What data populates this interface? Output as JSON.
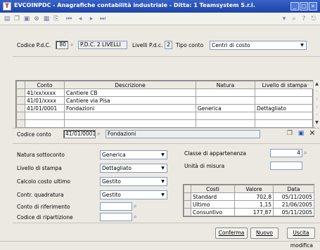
{
  "window": {
    "title": "EVCOINPDC - Anagrafiche contabilità industriale - Ditta: 1 Teamsystem S.r.l.",
    "app_icon": "T"
  },
  "header": {
    "codice_pdc_label": "Codice P.d.C.",
    "codice_pdc_value": "80",
    "pdc_desc": "P.D.C. 2 LIVELLI",
    "livelli_label": "Livelli P.d.c.",
    "livelli_value": "2",
    "tipo_conto_label": "Tipo conto",
    "tipo_conto_value": "Centri di costo"
  },
  "grid": {
    "columns": [
      "Conto",
      "Descrizione",
      "Natura",
      "Livello di stampa"
    ],
    "rows": [
      {
        "conto": "41/xx/xxxx",
        "descrizione": "Cantiere CB",
        "natura": "",
        "livello": ""
      },
      {
        "conto": "41/01/xxxx",
        "descrizione": "Cantiere via Pisa",
        "natura": "",
        "livello": ""
      },
      {
        "conto": "41/01/0001",
        "descrizione": "Fondazioni",
        "natura": "Generica",
        "livello": "Dettagliato"
      },
      {
        "conto": "",
        "descrizione": "",
        "natura": "",
        "livello": ""
      },
      {
        "conto": "",
        "descrizione": "",
        "natura": "",
        "livello": ""
      }
    ]
  },
  "detail": {
    "codice_conto_label": "Codice conto",
    "codice_conto_value": "41/01/0001",
    "codice_conto_desc": "Fondazioni",
    "natura_label": "Natura sottoconto",
    "natura_value": "Generica",
    "livello_label": "Livello di stampa",
    "livello_value": "Dettagliato",
    "calcolo_label": "Calcolo costo ultimo",
    "calcolo_value": "Gestito",
    "quadratura_label": "Contr. quadratura",
    "quadratura_value": "Gestito",
    "riferimento_label": "Conto di riferimento",
    "ripartizione_label": "Codice di ripartizione",
    "classe_label": "Classe di appartenenza",
    "classe_value": "4",
    "unita_label": "Unità di misura"
  },
  "costs": {
    "columns": [
      "Costi",
      "Valore",
      "Data"
    ],
    "rows": [
      {
        "costo": "Standard",
        "valore": "702,8",
        "data": "05/11/2005"
      },
      {
        "costo": "Ultimo",
        "valore": "1,15",
        "data": "21/06/2005"
      },
      {
        "costo": "Consuntivo",
        "valore": "177,87",
        "data": "05/11/2005"
      }
    ]
  },
  "buttons": {
    "conferma": "Conferma",
    "nuovo": "Nuovo",
    "uscita": "Uscita"
  },
  "status": {
    "mode": "modifica"
  },
  "colors": {
    "titlebar": "#2a52b8",
    "window_bg": "#ece9e3"
  }
}
